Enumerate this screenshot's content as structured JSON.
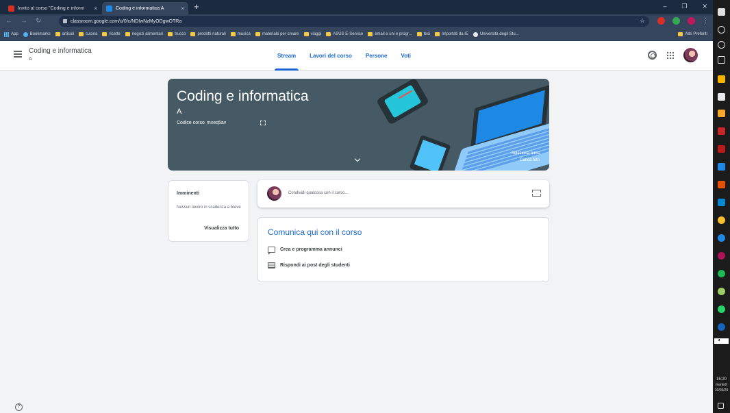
{
  "browser": {
    "tabs": [
      {
        "title": "Invito al corso \"Coding e inform",
        "close": "×"
      },
      {
        "title": "Coding e informatica A",
        "close": "×"
      }
    ],
    "new_tab": "+",
    "url": "classroom.google.com/u/0/c/NDIwNzMyODgwOTRa",
    "bookmarks": [
      "App",
      "Bookmarks",
      "articoli",
      "cucina",
      "ricette",
      "negozi alimentari",
      "trucco",
      "prodotti naturali",
      "musica",
      "materiale per creare",
      "viaggi",
      "ASUS E-Service",
      "email e uni e progr...",
      "tesi",
      "Importati da IE",
      "Università degli Stu..."
    ],
    "other_bookmarks": "Altri Preferiti"
  },
  "header": {
    "title": "Coding e informatica",
    "section": "A",
    "tabs": [
      "Stream",
      "Lavori del corso",
      "Persone",
      "Voti"
    ],
    "active_tab": "Stream"
  },
  "banner": {
    "title": "Coding e informatica",
    "section": "A",
    "code_label": "Codice corso",
    "code": "mxeq5av",
    "select_theme": "Seleziona tema",
    "upload_photo": "Carica foto",
    "color": "#455a64"
  },
  "upcoming": {
    "title": "Imminenti",
    "text": "Nessun lavoro in scadenza a breve",
    "link": "Visualizza tutto"
  },
  "share": {
    "placeholder": "Condividi qualcosa con il corso..."
  },
  "communicate": {
    "title": "Comunica qui con il corso",
    "items": [
      "Crea e programma annunci",
      "Rispondi ai post degli studenti"
    ]
  },
  "taskbar": {
    "time": "15:20",
    "day": "martedì",
    "date": "10/03/20"
  },
  "colors": {
    "accent": "#1967d2",
    "browser_frame": "#35455d"
  }
}
